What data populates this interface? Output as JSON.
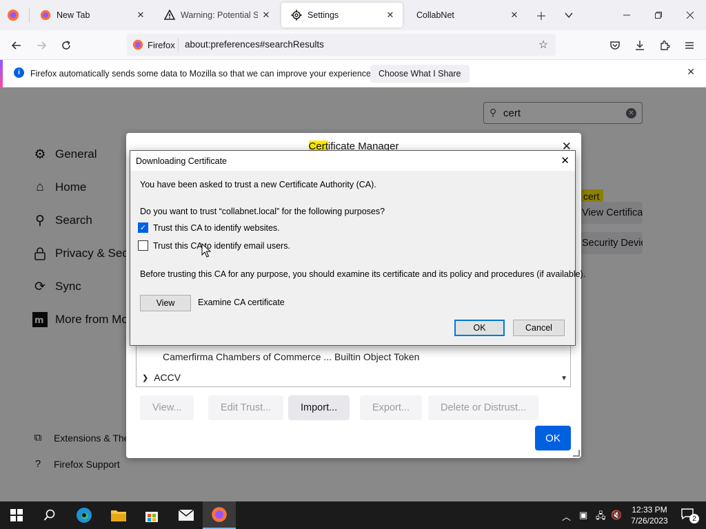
{
  "browser": {
    "tabs": [
      {
        "title": "New Tab"
      },
      {
        "title": "Warning: Potential Securi"
      },
      {
        "title": "Settings"
      },
      {
        "title": "CollabNet"
      }
    ],
    "identity_label": "Firefox",
    "url": "about:preferences#searchResults"
  },
  "notification": {
    "text": "Firefox automatically sends some data to Mozilla so that we can improve your experience.",
    "button_label": "Choose What I Share"
  },
  "preferences": {
    "search_value": "cert",
    "categories": [
      "General",
      "Home",
      "Search",
      "Privacy & Security",
      "Sync",
      "More from Mozilla"
    ],
    "footer": [
      "Extensions & Themes",
      "Firefox Support"
    ],
    "highlight_word": "cert",
    "behind_buttons": [
      "View Certificates...",
      "Security Devices..."
    ]
  },
  "cert_manager": {
    "title_highlight": "Cert",
    "title_rest": "ificate Manager",
    "visible_rows": [
      "Camerfirma Chambers of Commerce ... Builtin Object Token",
      "ACCV"
    ],
    "buttons": [
      "View...",
      "Edit Trust...",
      "Import...",
      "Export...",
      "Delete or Distrust..."
    ],
    "ok_label": "OK"
  },
  "download_dialog": {
    "title": "Downloading Certificate",
    "intro": "You have been asked to trust a new Certificate Authority (CA).",
    "question": "Do you want to trust “collabnet.local” for the following purposes?",
    "options": [
      {
        "label": "Trust this CA to identify websites.",
        "checked": true
      },
      {
        "label": "Trust this CA to identify email users.",
        "checked": false
      }
    ],
    "advice": "Before trusting this CA for any purpose, you should examine its certificate and its policy and procedures (if available).",
    "view_label": "View",
    "examine_label": "Examine CA certificate",
    "ok_label": "OK",
    "cancel_label": "Cancel"
  },
  "taskbar": {
    "time": "12:33 PM",
    "date": "7/26/2023",
    "notification_count": "2"
  },
  "colors": {
    "accent": "#0061e0",
    "highlight": "#ffe900",
    "taskbar": "#1b1b1b"
  }
}
